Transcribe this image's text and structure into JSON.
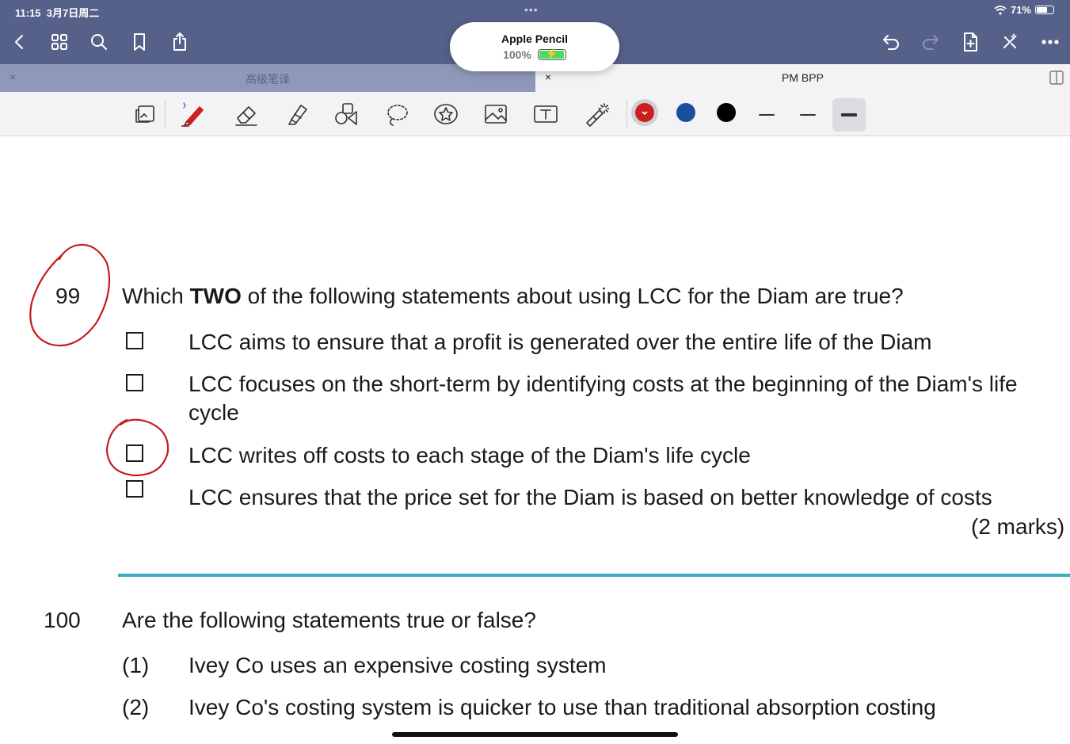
{
  "status_bar": {
    "time": "11:15",
    "date": "3月7日周二",
    "dots": "•••",
    "battery_pct": "71%",
    "battery_level": 0.71
  },
  "top_toolbar": {
    "left_icons": [
      "back-icon",
      "grid-icon",
      "search-icon",
      "bookmark-icon",
      "share-icon"
    ],
    "right_icons": [
      "undo-icon",
      "redo-icon",
      "add-page-icon",
      "close-edit-icon",
      "more-icon"
    ]
  },
  "pencil_popup": {
    "name": "Apple Pencil",
    "battery_text": "100%",
    "battery_level": 1.0,
    "battery_color": "#4cd964"
  },
  "tabs": [
    {
      "title": "高级笔译",
      "close": "×",
      "active": false
    },
    {
      "title": "PM BPP",
      "close": "×",
      "active": true
    }
  ],
  "drawing_toolbar": {
    "tools": [
      "page-layout-icon",
      "pen-icon",
      "eraser-icon",
      "highlighter-icon",
      "shapes-icon",
      "lasso-icon",
      "sticker-icon",
      "image-icon",
      "text-icon",
      "laser-pointer-icon"
    ],
    "colors": [
      "#cc1f1f",
      "#1c4ea0",
      "#000000"
    ],
    "selected_color": "#cc1f1f",
    "line_widths": [
      "thin",
      "medium",
      "thick"
    ],
    "selected_width": "thick"
  },
  "question_99": {
    "number": "99",
    "prefix": "Which ",
    "bold": "TWO",
    "suffix": " of the following statements about using LCC for the Diam are true?",
    "options": [
      "LCC aims to ensure that a profit is generated over the entire life of the Diam",
      "LCC focuses on the short-term by identifying costs at the beginning of the Diam's life cycle",
      "LCC writes off costs to each stage of the Diam's life cycle",
      "LCC ensures that the price set for the Diam is based on better knowledge of costs"
    ],
    "marks": "(2 marks)"
  },
  "question_100": {
    "number": "100",
    "text": "Are the following statements true or false?",
    "statements": [
      {
        "label": "(1)",
        "text": "Ivey Co uses an expensive costing system"
      },
      {
        "label": "(2)",
        "text": "Ivey Co's costing system is quicker to use than traditional absorption costing"
      }
    ]
  },
  "annotation_color": "#c41e1e"
}
